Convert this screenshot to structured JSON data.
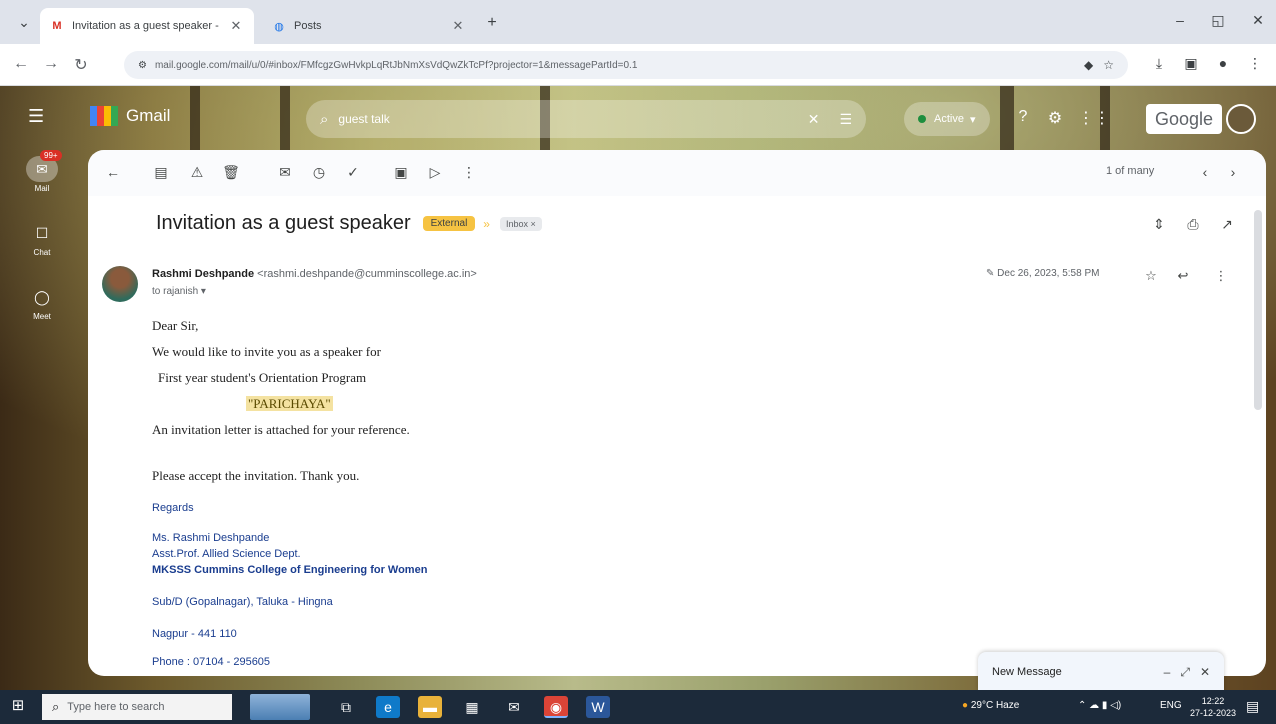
{
  "browser": {
    "tabs": [
      {
        "label": "Invitation as a guest speaker - ",
        "favicon": "M",
        "favicon_color": "#d93025",
        "active": true
      },
      {
        "label": "Posts",
        "favicon": "◍",
        "favicon_color": "#1a73e8",
        "active": false
      }
    ],
    "new_tab": "+",
    "url": "mail.google.com/mail/u/0/#inbox/FMfcgzGwHvkpLqRtJbNmXsVdQwZkTcPf?projector=1&messagePartId=0.1",
    "window_controls": {
      "minimize": "–",
      "maximize": "◱",
      "close": "✕"
    }
  },
  "gmail": {
    "app_name": "Gmail",
    "search_text": "guest talk",
    "status": "Active",
    "google_label": "Google",
    "rail": [
      {
        "label": "Mail",
        "icon": "✉",
        "badge": "99+"
      },
      {
        "label": "Chat",
        "icon": "☐",
        "badge": ""
      },
      {
        "label": "Meet",
        "icon": "◯",
        "badge": ""
      }
    ],
    "paging": "1 of many",
    "message": {
      "subject": "Invitation as a guest speaker",
      "label": "External",
      "inbox_chip": "Inbox ×",
      "sender_name": "Rashmi Deshpande",
      "sender_email": "<rashmi.deshpande@cumminscollege.ac.in>",
      "to": "to rajanish ▾",
      "date": "Dec 26, 2023, 5:58 PM",
      "body": [
        "Dear Sir,",
        "We would like to invite you as a speaker for",
        "First year student's Orientation Program",
        "\"PARICHAYA\".",
        "An invitation letter is attached for your reference.",
        "Please accept the invitation. Thank you."
      ],
      "event_name": "\"PARICHAYA\"",
      "signature": [
        "Regards",
        "Ms. Rashmi Deshpande",
        "Asst.Prof. Allied Science Dept.",
        "MKSSS Cummins College of Engineering for Women",
        "Sub/D (Gopalnagar), Taluka - Hingna",
        "Nagpur - 441 110",
        "Phone : 07104 - 295605"
      ]
    },
    "new_message": "New Message"
  },
  "taskbar": {
    "search_placeholder": "Type here to search",
    "weather": "29°C Haze",
    "lang": "ENG",
    "time": "12:22",
    "date": "27-12-2023"
  }
}
